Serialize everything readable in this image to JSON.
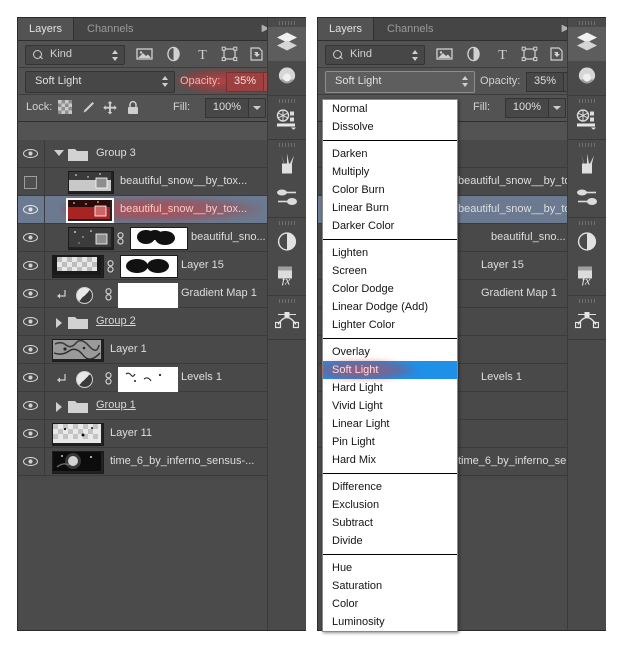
{
  "app": "Adobe Photoshop Layers Panel",
  "panel": {
    "tabs": [
      {
        "label": "Layers",
        "active": true
      },
      {
        "label": "Channels",
        "active": false
      }
    ],
    "filter": {
      "kind_label": "Kind",
      "icons": [
        "image-filter-icon",
        "adjustment-filter-icon",
        "type-filter-icon",
        "shape-filter-icon",
        "smart-object-filter-icon"
      ],
      "toggle": "filter-enable-toggle"
    },
    "blend": {
      "mode": "Soft Light",
      "opacity_label": "Opacity:",
      "opacity_value": "35%"
    },
    "lock": {
      "label": "Lock:",
      "icons": [
        "lock-transparent-pixels-icon",
        "lock-image-pixels-icon",
        "lock-position-icon",
        "lock-all-icon"
      ],
      "fill_label": "Fill:",
      "fill_value": "100%"
    },
    "layers": [
      {
        "name": "Group 3",
        "type": "group",
        "visible": true,
        "expanded": true,
        "selected": false
      },
      {
        "name": "beautiful_snow__by_tox...",
        "type": "smart",
        "visible": false,
        "selected": false
      },
      {
        "name": "beautiful_snow__by_tox...",
        "type": "smart",
        "visible": true,
        "selected": true
      },
      {
        "name": "beautiful_sno...",
        "type": "masked",
        "visible": true,
        "selected": false
      },
      {
        "name": "Layer 15",
        "type": "masked",
        "visible": true,
        "selected": false
      },
      {
        "name": "Gradient Map 1",
        "type": "adjustment",
        "visible": true,
        "clipped": true,
        "selected": false
      },
      {
        "name": "Group 2",
        "type": "group",
        "visible": true,
        "expanded": false,
        "selected": false
      },
      {
        "name": "Layer 1",
        "type": "pixel",
        "visible": true,
        "selected": false
      },
      {
        "name": "Levels 1",
        "type": "adjustment",
        "visible": true,
        "clipped": true,
        "selected": false
      },
      {
        "name": "Group 1",
        "type": "group",
        "visible": true,
        "expanded": false,
        "selected": false
      },
      {
        "name": "Layer 11",
        "type": "pixel",
        "visible": true,
        "selected": false
      },
      {
        "name": "time_6_by_inferno_sensus-...",
        "type": "pixel",
        "visible": true,
        "selected": false
      }
    ],
    "dock_icons": [
      "layers-panel-icon",
      "color-panel-icon",
      "properties-panel-icon",
      "brush-panel-icon",
      "brush-presets-panel-icon",
      "adjustments-panel-icon",
      "styles-fx-panel-icon",
      "paths-panel-icon"
    ]
  },
  "blend_menu": {
    "selected": "Soft Light",
    "groups": [
      [
        "Normal",
        "Dissolve"
      ],
      [
        "Darken",
        "Multiply",
        "Color Burn",
        "Linear Burn",
        "Darker Color"
      ],
      [
        "Lighten",
        "Screen",
        "Color Dodge",
        "Linear Dodge (Add)",
        "Lighter Color"
      ],
      [
        "Overlay",
        "Soft Light",
        "Hard Light",
        "Vivid Light",
        "Linear Light",
        "Pin Light",
        "Hard Mix"
      ],
      [
        "Difference",
        "Exclusion",
        "Subtract",
        "Divide"
      ],
      [
        "Hue",
        "Saturation",
        "Color",
        "Luminosity"
      ]
    ]
  },
  "colors": {
    "panel_bg": "#535353",
    "list_bg": "#494949",
    "selection": "#6b7a90",
    "highlight_red": "#d83a3a",
    "menu_highlight": "#1e90e8",
    "text": "#dedede"
  }
}
